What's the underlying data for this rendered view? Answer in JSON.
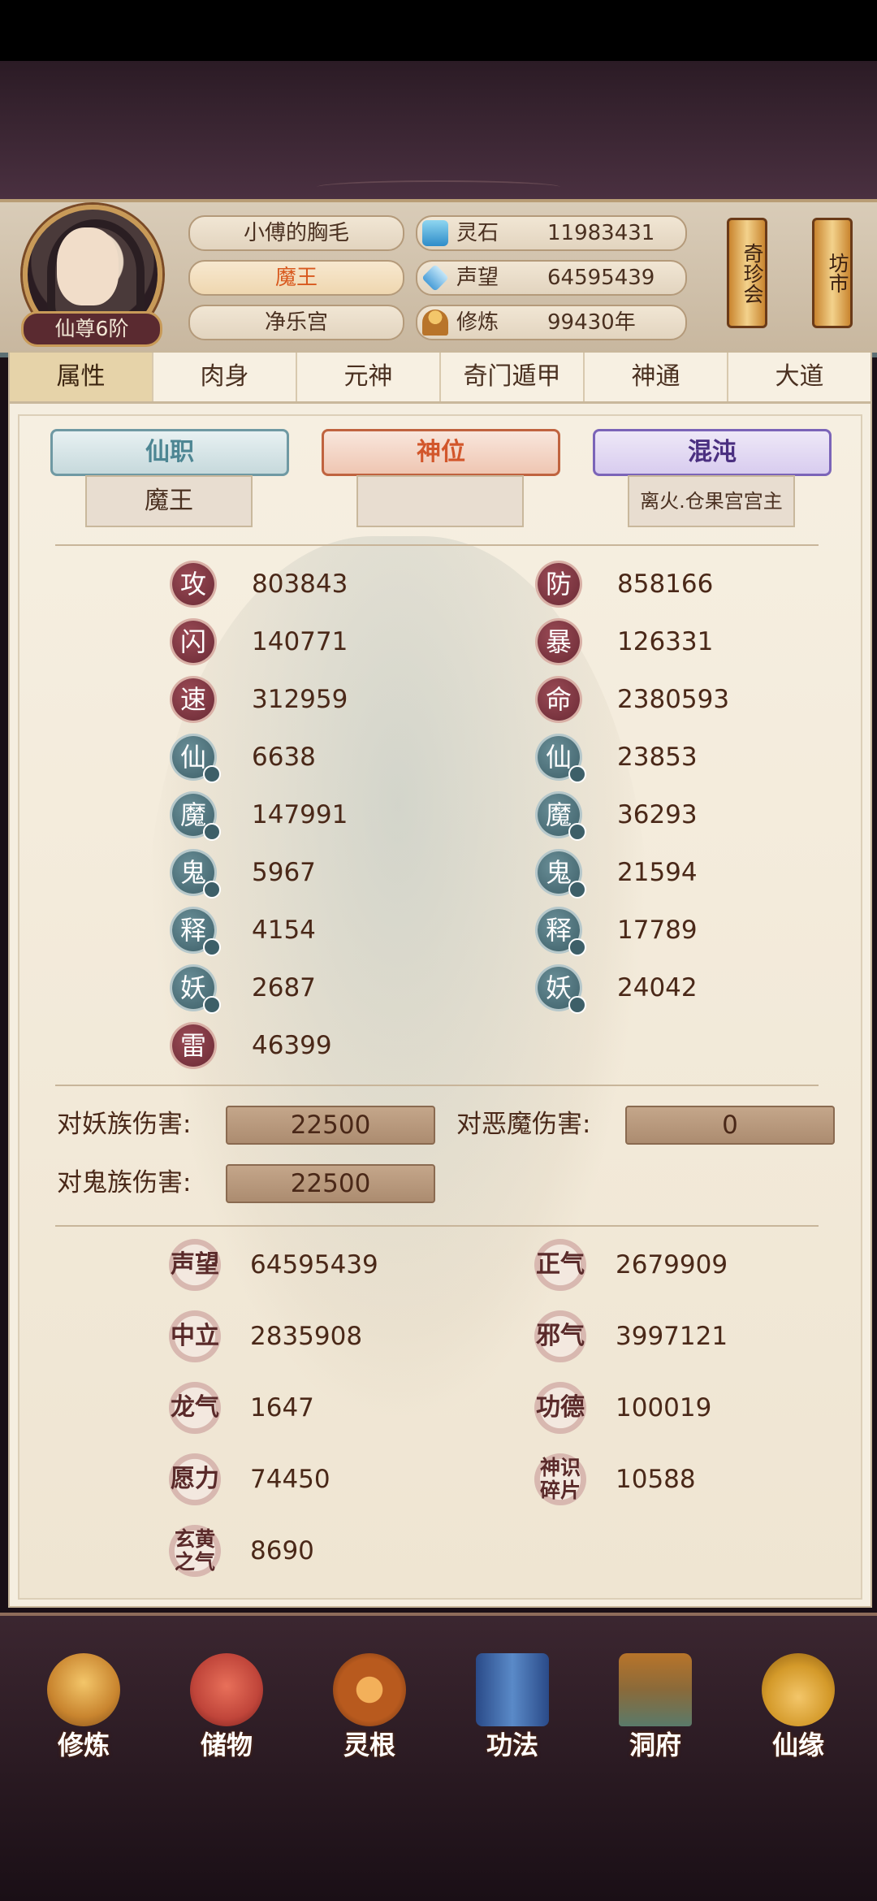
{
  "header": {
    "rank": "仙尊6阶",
    "name": "小傅的胸毛",
    "title": "魔王",
    "sect": "净乐宫",
    "resources": [
      {
        "label": "灵石",
        "value": "11983431",
        "icon": "spirit-stone-icon"
      },
      {
        "label": "声望",
        "value": "64595439",
        "icon": "reputation-crystal-icon"
      },
      {
        "label": "修炼",
        "value": "99430年",
        "icon": "meditation-icon"
      }
    ],
    "scroll_buttons": [
      "奇珍会",
      "坊市"
    ]
  },
  "tabs": [
    "属性",
    "肉身",
    "元神",
    "奇门遁甲",
    "神通",
    "大道"
  ],
  "banners": {
    "xianzhi": {
      "label": "仙职",
      "value": "魔王"
    },
    "shenwei": {
      "label": "神位",
      "value": ""
    },
    "hundun": {
      "label": "混沌",
      "value": "离火.仓果宫宫主"
    }
  },
  "stats": {
    "left": [
      {
        "label": "攻",
        "value": "803843",
        "type": "red"
      },
      {
        "label": "闪",
        "value": "140771",
        "type": "red"
      },
      {
        "label": "速",
        "value": "312959",
        "type": "red"
      },
      {
        "label": "仙",
        "value": "6638",
        "type": "teal"
      },
      {
        "label": "魔",
        "value": "147991",
        "type": "teal"
      },
      {
        "label": "鬼",
        "value": "5967",
        "type": "teal"
      },
      {
        "label": "释",
        "value": "4154",
        "type": "teal"
      },
      {
        "label": "妖",
        "value": "2687",
        "type": "teal"
      },
      {
        "label": "雷",
        "value": "46399",
        "type": "red"
      }
    ],
    "right": [
      {
        "label": "防",
        "value": "858166",
        "type": "red"
      },
      {
        "label": "暴",
        "value": "126331",
        "type": "red"
      },
      {
        "label": "命",
        "value": "2380593",
        "type": "red"
      },
      {
        "label": "仙",
        "value": "23853",
        "type": "teal"
      },
      {
        "label": "魔",
        "value": "36293",
        "type": "teal"
      },
      {
        "label": "鬼",
        "value": "21594",
        "type": "teal"
      },
      {
        "label": "释",
        "value": "17789",
        "type": "teal"
      },
      {
        "label": "妖",
        "value": "24042",
        "type": "teal"
      }
    ]
  },
  "damage": {
    "yao_label": "对妖族伤害:",
    "yao_value": "22500",
    "emo_label": "对恶魔伤害:",
    "emo_value": "0",
    "gui_label": "对鬼族伤害:",
    "gui_value": "22500"
  },
  "special": {
    "left": [
      {
        "label": "声望",
        "value": "64595439"
      },
      {
        "label": "中立",
        "value": "2835908"
      },
      {
        "label": "龙气",
        "value": "1647"
      },
      {
        "label": "愿力",
        "value": "74450"
      },
      {
        "label": "玄黄之气",
        "value": "8690"
      }
    ],
    "right": [
      {
        "label": "正气",
        "value": "2679909"
      },
      {
        "label": "邪气",
        "value": "3997121"
      },
      {
        "label": "功德",
        "value": "100019"
      },
      {
        "label": "神识碎片",
        "value": "10588"
      }
    ]
  },
  "bottom_nav": [
    {
      "label": "修炼",
      "icon": "cultivation-icon",
      "color": "#c9852f"
    },
    {
      "label": "储物",
      "icon": "storage-bag-icon",
      "color": "#c0453a"
    },
    {
      "label": "灵根",
      "icon": "spirit-root-icon",
      "color": "#b85a1e"
    },
    {
      "label": "功法",
      "icon": "technique-book-icon",
      "color": "#3a6aa8"
    },
    {
      "label": "洞府",
      "icon": "cave-dwelling-icon",
      "color": "#8a6a3a"
    },
    {
      "label": "仙缘",
      "icon": "gourd-icon",
      "color": "#d49a2a"
    }
  ]
}
